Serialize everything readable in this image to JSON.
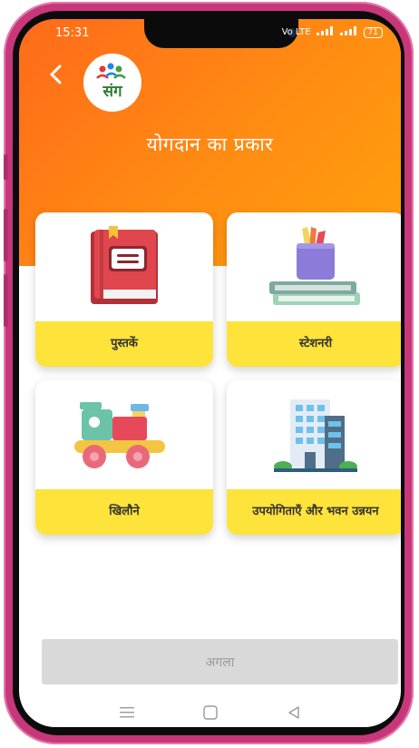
{
  "status_bar": {
    "time": "15:31",
    "network": "Vo LTE",
    "battery": "71"
  },
  "header": {
    "title": "योगदान का प्रकार",
    "logo_text": "संग"
  },
  "categories": [
    {
      "label": "पुस्तकें",
      "icon": "book-icon"
    },
    {
      "label": "स्टेशनरी",
      "icon": "stationery-icon"
    },
    {
      "label": "खिलौने",
      "icon": "toy-train-icon"
    },
    {
      "label": "उपयोगिताएँ और भवन उन्नयन",
      "icon": "building-icon"
    }
  ],
  "footer": {
    "next_label": "अगला"
  },
  "colors": {
    "header_start": "#ff6a1a",
    "header_end": "#ffa10c",
    "card_label_bg": "#fde33a",
    "button_disabled": "#d9d9d9"
  }
}
